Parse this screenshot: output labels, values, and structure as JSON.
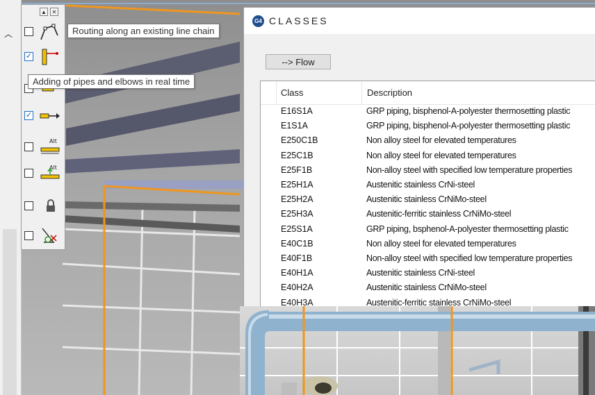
{
  "toolbox": {
    "minimize_glyph": "▲",
    "close_glyph": "✕",
    "tools": [
      {
        "checked": false,
        "icon": "polyline-route-icon"
      },
      {
        "checked": true,
        "icon": "pipe-elbow-icon"
      },
      {
        "checked": false,
        "icon": "pipe-connect-icon"
      },
      {
        "checked": true,
        "icon": "pipe-arrow-icon"
      },
      {
        "checked": false,
        "icon": "alt-pipe-icon",
        "badge": "Alt"
      },
      {
        "checked": false,
        "icon": "alt-pipe-up-icon",
        "badge": "Alt"
      },
      {
        "checked": false,
        "icon": "lock-icon"
      },
      {
        "checked": false,
        "icon": "angle-tool-icon"
      }
    ]
  },
  "tooltips": {
    "routing": "Routing along an existing line chain",
    "adding": "Adding of pipes and elbows in real time"
  },
  "dialog": {
    "icon_text": "G4",
    "title": "CLASSES",
    "flow_button": "--> Flow",
    "columns": {
      "class": "Class",
      "description": "Description"
    },
    "rows": [
      {
        "class": "E16S1A",
        "description": "GRP piping, bisphenol-A-polyester thermosetting plastic"
      },
      {
        "class": "E1S1A",
        "description": "GRP piping, bisphenol-A-polyester thermosetting plastic"
      },
      {
        "class": "E250C1B",
        "description": "Non alloy steel for elevated temperatures"
      },
      {
        "class": "E25C1B",
        "description": "Non alloy steel for elevated temperatures"
      },
      {
        "class": "E25F1B",
        "description": "Non-alloy steel with specified low temperature properties"
      },
      {
        "class": "E25H1A",
        "description": "Austenitic stainless CrNi-steel"
      },
      {
        "class": "E25H2A",
        "description": "Austenitic stainless CrNiMo-steel"
      },
      {
        "class": "E25H3A",
        "description": "Austenitic-ferritic stainless CrNiMo-steel"
      },
      {
        "class": "E25S1A",
        "description": "GRP piping, bsphenol-A-polyester thermosetting plastic"
      },
      {
        "class": "E40C1B",
        "description": "Non alloy steel for elevated temperatures"
      },
      {
        "class": "E40F1B",
        "description": "Non-alloy steel with specified low temperature properties"
      },
      {
        "class": "E40H1A",
        "description": "Austenitic stainless CrNi-steel"
      },
      {
        "class": "E40H2A",
        "description": "Austenitic stainless CrNiMo-steel"
      },
      {
        "class": "E40H3A",
        "description": "Austenitic-ferritic stainless CrNiMo-steel"
      }
    ]
  },
  "colors": {
    "accent_orange": "#f0961e",
    "pipe_blue": "#8fb2cf",
    "icon_yellow": "#f2c200"
  }
}
